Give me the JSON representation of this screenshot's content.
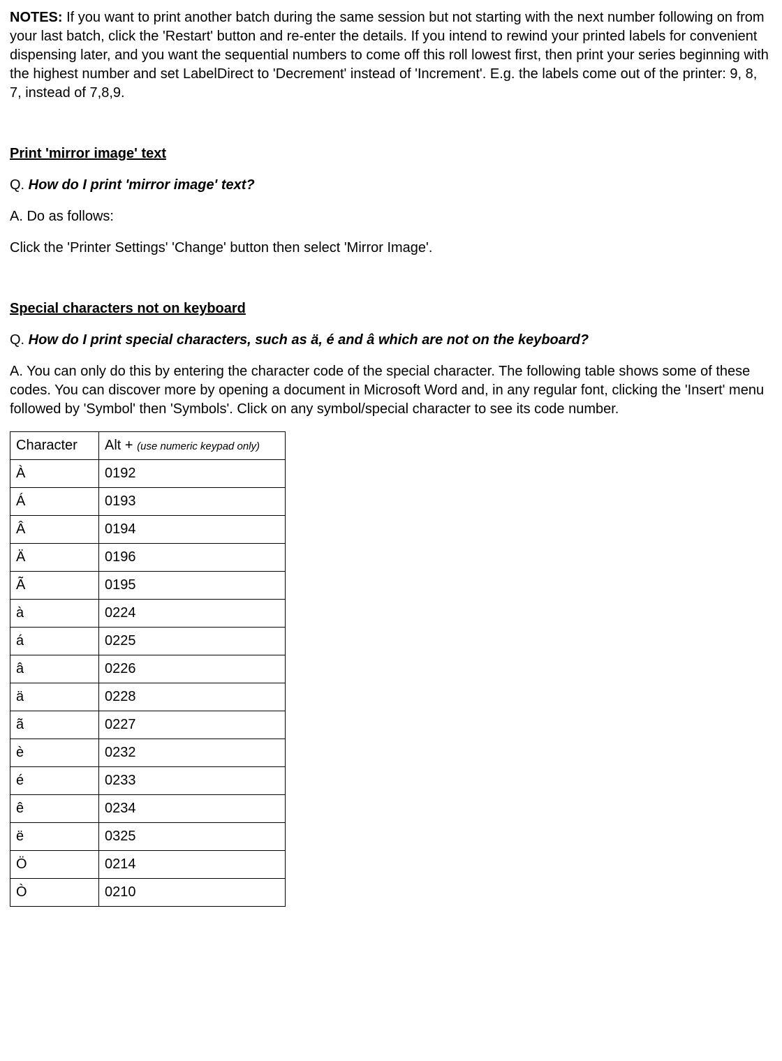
{
  "notes": {
    "label": "NOTES:",
    "text": "  If you want to print another batch during the same session but not starting with the next number following on from your last batch, click the 'Restart' button and re-enter the details.  If you intend to rewind your printed labels for convenient dispensing later, and you want the sequential numbers to come off this roll lowest first, then print your series beginning with the highest number and set LabelDirect to 'Decrement' instead of 'Increment'.  E.g. the labels come out of the printer: 9, 8, 7, instead of 7,8,9."
  },
  "mirror": {
    "heading": "Print 'mirror image' text",
    "q_prefix": "Q.  ",
    "q_text": "How do I print 'mirror image' text?",
    "a_line": "A.  Do as follows:",
    "instruction": "Click the 'Printer Settings'  'Change' button then select 'Mirror Image'."
  },
  "special": {
    "heading": "Special characters not on keyboard",
    "q_prefix": "Q.  ",
    "q_text": "How do I print special characters, such as  ä, é  and  â  which are not on the keyboard?",
    "a_text": "A.  You can only do this by entering the character code of the special  character.  The following table shows some of these codes.  You can discover more by opening a document in Microsoft Word and, in any regular font, clicking the 'Insert' menu followed by 'Symbol' then 'Symbols'.  Click on any symbol/special character to see its code number."
  },
  "table": {
    "header_char": "Character",
    "header_code_main": "Alt + ",
    "header_code_note": "(use numeric keypad only)",
    "rows": [
      {
        "char": "À",
        "code": "0192"
      },
      {
        "char": "Á",
        "code": "0193"
      },
      {
        "char": "Â",
        "code": "0194"
      },
      {
        "char": "Ä",
        "code": "0196"
      },
      {
        "char": "Ã",
        "code": "0195"
      },
      {
        "char": "à",
        "code": "0224"
      },
      {
        "char": "á",
        "code": "0225"
      },
      {
        "char": "â",
        "code": "0226"
      },
      {
        "char": "ä",
        "code": "0228"
      },
      {
        "char": "ã",
        "code": "0227"
      },
      {
        "char": "è",
        "code": "0232"
      },
      {
        "char": "é",
        "code": "0233"
      },
      {
        "char": "ê",
        "code": "0234"
      },
      {
        "char": "ë",
        "code": "0325"
      },
      {
        "char": "Ö",
        "code": "0214"
      },
      {
        "char": "Ò",
        "code": "0210"
      }
    ]
  }
}
